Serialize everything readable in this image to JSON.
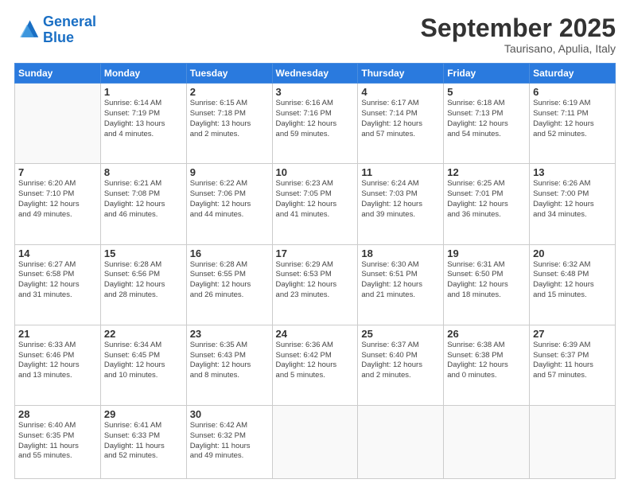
{
  "header": {
    "logo_line1": "General",
    "logo_line2": "Blue",
    "month": "September 2025",
    "location": "Taurisano, Apulia, Italy"
  },
  "days_of_week": [
    "Sunday",
    "Monday",
    "Tuesday",
    "Wednesday",
    "Thursday",
    "Friday",
    "Saturday"
  ],
  "weeks": [
    [
      {
        "num": "",
        "info": ""
      },
      {
        "num": "1",
        "info": "Sunrise: 6:14 AM\nSunset: 7:19 PM\nDaylight: 13 hours\nand 4 minutes."
      },
      {
        "num": "2",
        "info": "Sunrise: 6:15 AM\nSunset: 7:18 PM\nDaylight: 13 hours\nand 2 minutes."
      },
      {
        "num": "3",
        "info": "Sunrise: 6:16 AM\nSunset: 7:16 PM\nDaylight: 12 hours\nand 59 minutes."
      },
      {
        "num": "4",
        "info": "Sunrise: 6:17 AM\nSunset: 7:14 PM\nDaylight: 12 hours\nand 57 minutes."
      },
      {
        "num": "5",
        "info": "Sunrise: 6:18 AM\nSunset: 7:13 PM\nDaylight: 12 hours\nand 54 minutes."
      },
      {
        "num": "6",
        "info": "Sunrise: 6:19 AM\nSunset: 7:11 PM\nDaylight: 12 hours\nand 52 minutes."
      }
    ],
    [
      {
        "num": "7",
        "info": "Sunrise: 6:20 AM\nSunset: 7:10 PM\nDaylight: 12 hours\nand 49 minutes."
      },
      {
        "num": "8",
        "info": "Sunrise: 6:21 AM\nSunset: 7:08 PM\nDaylight: 12 hours\nand 46 minutes."
      },
      {
        "num": "9",
        "info": "Sunrise: 6:22 AM\nSunset: 7:06 PM\nDaylight: 12 hours\nand 44 minutes."
      },
      {
        "num": "10",
        "info": "Sunrise: 6:23 AM\nSunset: 7:05 PM\nDaylight: 12 hours\nand 41 minutes."
      },
      {
        "num": "11",
        "info": "Sunrise: 6:24 AM\nSunset: 7:03 PM\nDaylight: 12 hours\nand 39 minutes."
      },
      {
        "num": "12",
        "info": "Sunrise: 6:25 AM\nSunset: 7:01 PM\nDaylight: 12 hours\nand 36 minutes."
      },
      {
        "num": "13",
        "info": "Sunrise: 6:26 AM\nSunset: 7:00 PM\nDaylight: 12 hours\nand 34 minutes."
      }
    ],
    [
      {
        "num": "14",
        "info": "Sunrise: 6:27 AM\nSunset: 6:58 PM\nDaylight: 12 hours\nand 31 minutes."
      },
      {
        "num": "15",
        "info": "Sunrise: 6:28 AM\nSunset: 6:56 PM\nDaylight: 12 hours\nand 28 minutes."
      },
      {
        "num": "16",
        "info": "Sunrise: 6:28 AM\nSunset: 6:55 PM\nDaylight: 12 hours\nand 26 minutes."
      },
      {
        "num": "17",
        "info": "Sunrise: 6:29 AM\nSunset: 6:53 PM\nDaylight: 12 hours\nand 23 minutes."
      },
      {
        "num": "18",
        "info": "Sunrise: 6:30 AM\nSunset: 6:51 PM\nDaylight: 12 hours\nand 21 minutes."
      },
      {
        "num": "19",
        "info": "Sunrise: 6:31 AM\nSunset: 6:50 PM\nDaylight: 12 hours\nand 18 minutes."
      },
      {
        "num": "20",
        "info": "Sunrise: 6:32 AM\nSunset: 6:48 PM\nDaylight: 12 hours\nand 15 minutes."
      }
    ],
    [
      {
        "num": "21",
        "info": "Sunrise: 6:33 AM\nSunset: 6:46 PM\nDaylight: 12 hours\nand 13 minutes."
      },
      {
        "num": "22",
        "info": "Sunrise: 6:34 AM\nSunset: 6:45 PM\nDaylight: 12 hours\nand 10 minutes."
      },
      {
        "num": "23",
        "info": "Sunrise: 6:35 AM\nSunset: 6:43 PM\nDaylight: 12 hours\nand 8 minutes."
      },
      {
        "num": "24",
        "info": "Sunrise: 6:36 AM\nSunset: 6:42 PM\nDaylight: 12 hours\nand 5 minutes."
      },
      {
        "num": "25",
        "info": "Sunrise: 6:37 AM\nSunset: 6:40 PM\nDaylight: 12 hours\nand 2 minutes."
      },
      {
        "num": "26",
        "info": "Sunrise: 6:38 AM\nSunset: 6:38 PM\nDaylight: 12 hours\nand 0 minutes."
      },
      {
        "num": "27",
        "info": "Sunrise: 6:39 AM\nSunset: 6:37 PM\nDaylight: 11 hours\nand 57 minutes."
      }
    ],
    [
      {
        "num": "28",
        "info": "Sunrise: 6:40 AM\nSunset: 6:35 PM\nDaylight: 11 hours\nand 55 minutes."
      },
      {
        "num": "29",
        "info": "Sunrise: 6:41 AM\nSunset: 6:33 PM\nDaylight: 11 hours\nand 52 minutes."
      },
      {
        "num": "30",
        "info": "Sunrise: 6:42 AM\nSunset: 6:32 PM\nDaylight: 11 hours\nand 49 minutes."
      },
      {
        "num": "",
        "info": ""
      },
      {
        "num": "",
        "info": ""
      },
      {
        "num": "",
        "info": ""
      },
      {
        "num": "",
        "info": ""
      }
    ]
  ]
}
